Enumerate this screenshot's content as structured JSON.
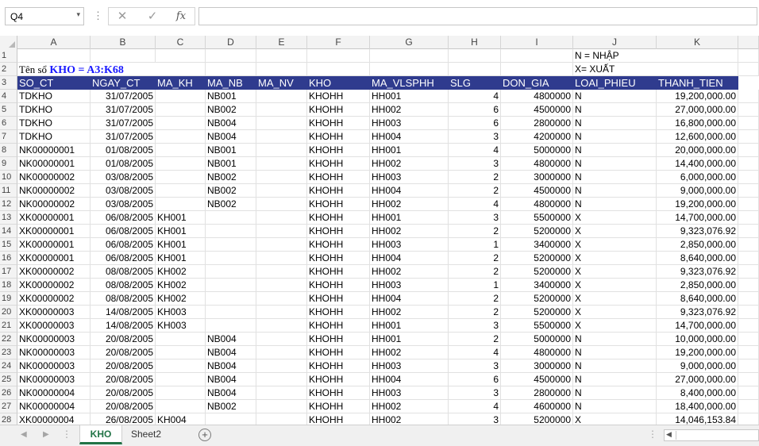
{
  "formula_bar": {
    "name_box": "Q4",
    "name_box_arrow": "▾",
    "dots": "⋮",
    "cancel_glyph": "✕",
    "enter_glyph": "✓",
    "fx_glyph": "fx",
    "formula": ""
  },
  "columns": [
    "A",
    "B",
    "C",
    "D",
    "E",
    "F",
    "G",
    "H",
    "I",
    "J",
    "K"
  ],
  "row1": {
    "num": "1",
    "J": "N = NHẬP"
  },
  "row2": {
    "num": "2",
    "label": "Tên sổ",
    "value": "KHO = A3:K68",
    "J": "X= XUẤT"
  },
  "header_row": {
    "num": "3",
    "cells": [
      "SO_CT",
      "NGAY_CT",
      "MA_KH",
      "MA_NB",
      "MA_NV",
      "KHO",
      "MA_VLSPHH",
      "SLG",
      "DON_GIA",
      "LOAI_PHIEU",
      "THANH_TIEN"
    ]
  },
  "rows": [
    {
      "n": "4",
      "a": "TDKHO",
      "b": "31/07/2005",
      "c": "",
      "d": "NB001",
      "e": "",
      "f": "KHOHH",
      "g": "HH001",
      "h": "4",
      "i": "4800000",
      "j": "N",
      "k": "19,200,000.00"
    },
    {
      "n": "5",
      "a": "TDKHO",
      "b": "31/07/2005",
      "c": "",
      "d": "NB002",
      "e": "",
      "f": "KHOHH",
      "g": "HH002",
      "h": "6",
      "i": "4500000",
      "j": "N",
      "k": "27,000,000.00"
    },
    {
      "n": "6",
      "a": "TDKHO",
      "b": "31/07/2005",
      "c": "",
      "d": "NB004",
      "e": "",
      "f": "KHOHH",
      "g": "HH003",
      "h": "6",
      "i": "2800000",
      "j": "N",
      "k": "16,800,000.00"
    },
    {
      "n": "7",
      "a": "TDKHO",
      "b": "31/07/2005",
      "c": "",
      "d": "NB004",
      "e": "",
      "f": "KHOHH",
      "g": "HH004",
      "h": "3",
      "i": "4200000",
      "j": "N",
      "k": "12,600,000.00"
    },
    {
      "n": "8",
      "a": "NK00000001",
      "b": "01/08/2005",
      "c": "",
      "d": "NB001",
      "e": "",
      "f": "KHOHH",
      "g": "HH001",
      "h": "4",
      "i": "5000000",
      "j": "N",
      "k": "20,000,000.00"
    },
    {
      "n": "9",
      "a": "NK00000001",
      "b": "01/08/2005",
      "c": "",
      "d": "NB001",
      "e": "",
      "f": "KHOHH",
      "g": "HH002",
      "h": "3",
      "i": "4800000",
      "j": "N",
      "k": "14,400,000.00"
    },
    {
      "n": "10",
      "a": "NK00000002",
      "b": "03/08/2005",
      "c": "",
      "d": "NB002",
      "e": "",
      "f": "KHOHH",
      "g": "HH003",
      "h": "2",
      "i": "3000000",
      "j": "N",
      "k": "6,000,000.00"
    },
    {
      "n": "11",
      "a": "NK00000002",
      "b": "03/08/2005",
      "c": "",
      "d": "NB002",
      "e": "",
      "f": "KHOHH",
      "g": "HH004",
      "h": "2",
      "i": "4500000",
      "j": "N",
      "k": "9,000,000.00"
    },
    {
      "n": "12",
      "a": "NK00000002",
      "b": "03/08/2005",
      "c": "",
      "d": "NB002",
      "e": "",
      "f": "KHOHH",
      "g": "HH002",
      "h": "4",
      "i": "4800000",
      "j": "N",
      "k": "19,200,000.00"
    },
    {
      "n": "13",
      "a": "XK00000001",
      "b": "06/08/2005",
      "c": "KH001",
      "d": "",
      "e": "",
      "f": "KHOHH",
      "g": "HH001",
      "h": "3",
      "i": "5500000",
      "j": "X",
      "k": "14,700,000.00"
    },
    {
      "n": "14",
      "a": "XK00000001",
      "b": "06/08/2005",
      "c": "KH001",
      "d": "",
      "e": "",
      "f": "KHOHH",
      "g": "HH002",
      "h": "2",
      "i": "5200000",
      "j": "X",
      "k": "9,323,076.92"
    },
    {
      "n": "15",
      "a": "XK00000001",
      "b": "06/08/2005",
      "c": "KH001",
      "d": "",
      "e": "",
      "f": "KHOHH",
      "g": "HH003",
      "h": "1",
      "i": "3400000",
      "j": "X",
      "k": "2,850,000.00"
    },
    {
      "n": "16",
      "a": "XK00000001",
      "b": "06/08/2005",
      "c": "KH001",
      "d": "",
      "e": "",
      "f": "KHOHH",
      "g": "HH004",
      "h": "2",
      "i": "5200000",
      "j": "X",
      "k": "8,640,000.00"
    },
    {
      "n": "17",
      "a": "XK00000002",
      "b": "08/08/2005",
      "c": "KH002",
      "d": "",
      "e": "",
      "f": "KHOHH",
      "g": "HH002",
      "h": "2",
      "i": "5200000",
      "j": "X",
      "k": "9,323,076.92"
    },
    {
      "n": "18",
      "a": "XK00000002",
      "b": "08/08/2005",
      "c": "KH002",
      "d": "",
      "e": "",
      "f": "KHOHH",
      "g": "HH003",
      "h": "1",
      "i": "3400000",
      "j": "X",
      "k": "2,850,000.00"
    },
    {
      "n": "19",
      "a": "XK00000002",
      "b": "08/08/2005",
      "c": "KH002",
      "d": "",
      "e": "",
      "f": "KHOHH",
      "g": "HH004",
      "h": "2",
      "i": "5200000",
      "j": "X",
      "k": "8,640,000.00"
    },
    {
      "n": "20",
      "a": "XK00000003",
      "b": "14/08/2005",
      "c": "KH003",
      "d": "",
      "e": "",
      "f": "KHOHH",
      "g": "HH002",
      "h": "2",
      "i": "5200000",
      "j": "X",
      "k": "9,323,076.92"
    },
    {
      "n": "21",
      "a": "XK00000003",
      "b": "14/08/2005",
      "c": "KH003",
      "d": "",
      "e": "",
      "f": "KHOHH",
      "g": "HH001",
      "h": "3",
      "i": "5500000",
      "j": "X",
      "k": "14,700,000.00"
    },
    {
      "n": "22",
      "a": "NK00000003",
      "b": "20/08/2005",
      "c": "",
      "d": "NB004",
      "e": "",
      "f": "KHOHH",
      "g": "HH001",
      "h": "2",
      "i": "5000000",
      "j": "N",
      "k": "10,000,000.00"
    },
    {
      "n": "23",
      "a": "NK00000003",
      "b": "20/08/2005",
      "c": "",
      "d": "NB004",
      "e": "",
      "f": "KHOHH",
      "g": "HH002",
      "h": "4",
      "i": "4800000",
      "j": "N",
      "k": "19,200,000.00"
    },
    {
      "n": "24",
      "a": "NK00000003",
      "b": "20/08/2005",
      "c": "",
      "d": "NB004",
      "e": "",
      "f": "KHOHH",
      "g": "HH003",
      "h": "3",
      "i": "3000000",
      "j": "N",
      "k": "9,000,000.00"
    },
    {
      "n": "25",
      "a": "NK00000003",
      "b": "20/08/2005",
      "c": "",
      "d": "NB004",
      "e": "",
      "f": "KHOHH",
      "g": "HH004",
      "h": "6",
      "i": "4500000",
      "j": "N",
      "k": "27,000,000.00"
    },
    {
      "n": "26",
      "a": "NK00000004",
      "b": "20/08/2005",
      "c": "",
      "d": "NB004",
      "e": "",
      "f": "KHOHH",
      "g": "HH003",
      "h": "3",
      "i": "2800000",
      "j": "N",
      "k": "8,400,000.00"
    },
    {
      "n": "27",
      "a": "NK00000004",
      "b": "20/08/2005",
      "c": "",
      "d": "NB002",
      "e": "",
      "f": "KHOHH",
      "g": "HH002",
      "h": "4",
      "i": "4600000",
      "j": "N",
      "k": "18,400,000.00"
    },
    {
      "n": "28",
      "a": "XK00000004",
      "b": "26/08/2005",
      "c": "KH004",
      "d": "",
      "e": "",
      "f": "KHOHH",
      "g": "HH002",
      "h": "3",
      "i": "5200000",
      "j": "X",
      "k": "14,046,153.84"
    }
  ],
  "tabs": {
    "nav_prev": "◀",
    "nav_next": "▶",
    "dots": "⋮",
    "active": "KHO",
    "other": "Sheet2",
    "add": "+",
    "scroll_left": "◀"
  }
}
